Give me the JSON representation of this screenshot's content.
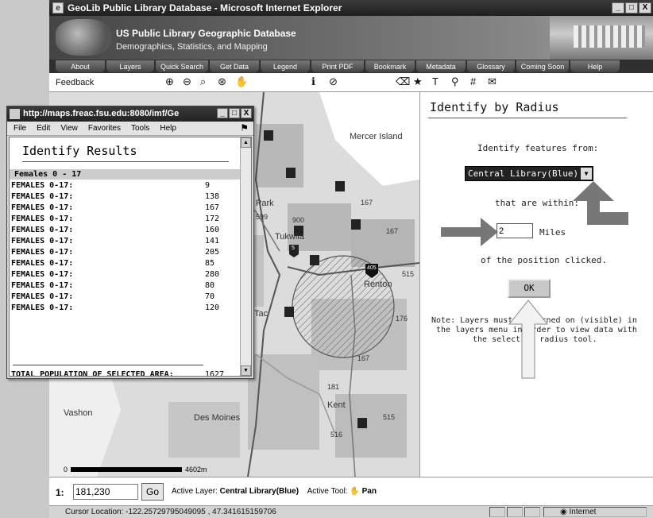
{
  "window": {
    "title": "GeoLib Public Library Database - Microsoft Internet Explorer",
    "min": "_",
    "max": "□",
    "close": "X"
  },
  "banner": {
    "title": "US Public Library Geographic Database",
    "subtitle": "Demographics, Statistics, and Mapping"
  },
  "nav": [
    "About",
    "Layers",
    "Quick Search",
    "Get Data",
    "Legend",
    "Print PDF",
    "Bookmark",
    "Metadata",
    "Glossary",
    "Coming Soon",
    "Help"
  ],
  "toolbar": {
    "feedback": "Feedback",
    "tools": [
      "⊕",
      "⊖",
      "⌕",
      "⊛",
      "✋",
      "ℹ",
      "⊘",
      "⌫",
      "★",
      "T",
      "⚲",
      "#",
      "✉"
    ]
  },
  "map": {
    "labels": {
      "mercer": "Mercer Island",
      "park": "Park",
      "tukwila": "Tukwila",
      "renton": "Renton",
      "tac": "Tac",
      "kent": "Kent",
      "vashon": "Vashon",
      "desmoines": "Des Moines",
      "r167a": "167",
      "r167b": "167",
      "r167c": "167",
      "r599": "599",
      "r900": "900",
      "r515a": "515",
      "r515b": "515",
      "r176": "176",
      "r181": "181",
      "r516": "516",
      "i405": "405",
      "r5": "5"
    },
    "scale_left": "0",
    "scale_right": "4602m"
  },
  "identify_panel": {
    "heading": "Identify by Radius",
    "line1": "Identify features from:",
    "select_value": "Central Library(Blue)",
    "line2": "that are within:",
    "radius_value": "2",
    "units": "Miles",
    "line3": "of the position clicked.",
    "ok": "OK",
    "note_line1": "Note: Layers must be turned on (visible) in",
    "note_line2": "the layers menu in order to view data with",
    "note_line3": "the select by radius tool."
  },
  "popup": {
    "title": "http://maps.freac.fsu.edu:8080/imf/Ge",
    "menu": [
      "File",
      "Edit",
      "View",
      "Favorites",
      "Tools",
      "Help"
    ],
    "heading": "Identify Results",
    "section": "Females 0 - 17",
    "rows": [
      {
        "label": "FEMALES 0-17:",
        "value": "9"
      },
      {
        "label": "FEMALES 0-17:",
        "value": "138"
      },
      {
        "label": "FEMALES 0-17:",
        "value": "167"
      },
      {
        "label": "FEMALES 0-17:",
        "value": "172"
      },
      {
        "label": "FEMALES 0-17:",
        "value": "160"
      },
      {
        "label": "FEMALES 0-17:",
        "value": "141"
      },
      {
        "label": "FEMALES 0-17:",
        "value": "205"
      },
      {
        "label": "FEMALES 0-17:",
        "value": "85"
      },
      {
        "label": "FEMALES 0-17:",
        "value": "280"
      },
      {
        "label": "FEMALES 0-17:",
        "value": "80"
      },
      {
        "label": "FEMALES 0-17:",
        "value": "70"
      },
      {
        "label": "FEMALES 0-17:",
        "value": "120"
      }
    ],
    "total_label": "TOTAL POPULATION OF SELECTED AREA:",
    "total_value": "1627"
  },
  "bottombar": {
    "scale_prefix": "1:",
    "scale_value": "181,230",
    "go": "Go",
    "active_layer_label": "Active Layer:",
    "active_layer": "Central Library(Blue)",
    "active_tool_label": "Active Tool:",
    "active_tool": "Pan"
  },
  "status": {
    "text": "Cursor Location: -122.25729795049095 , 47.341615159706",
    "zone": "Internet"
  },
  "colors": {
    "titlebar": "#2a2a2a",
    "map_bg": "#dcdcdc",
    "urban": "#b8b8b8",
    "water": "#ffffff"
  }
}
